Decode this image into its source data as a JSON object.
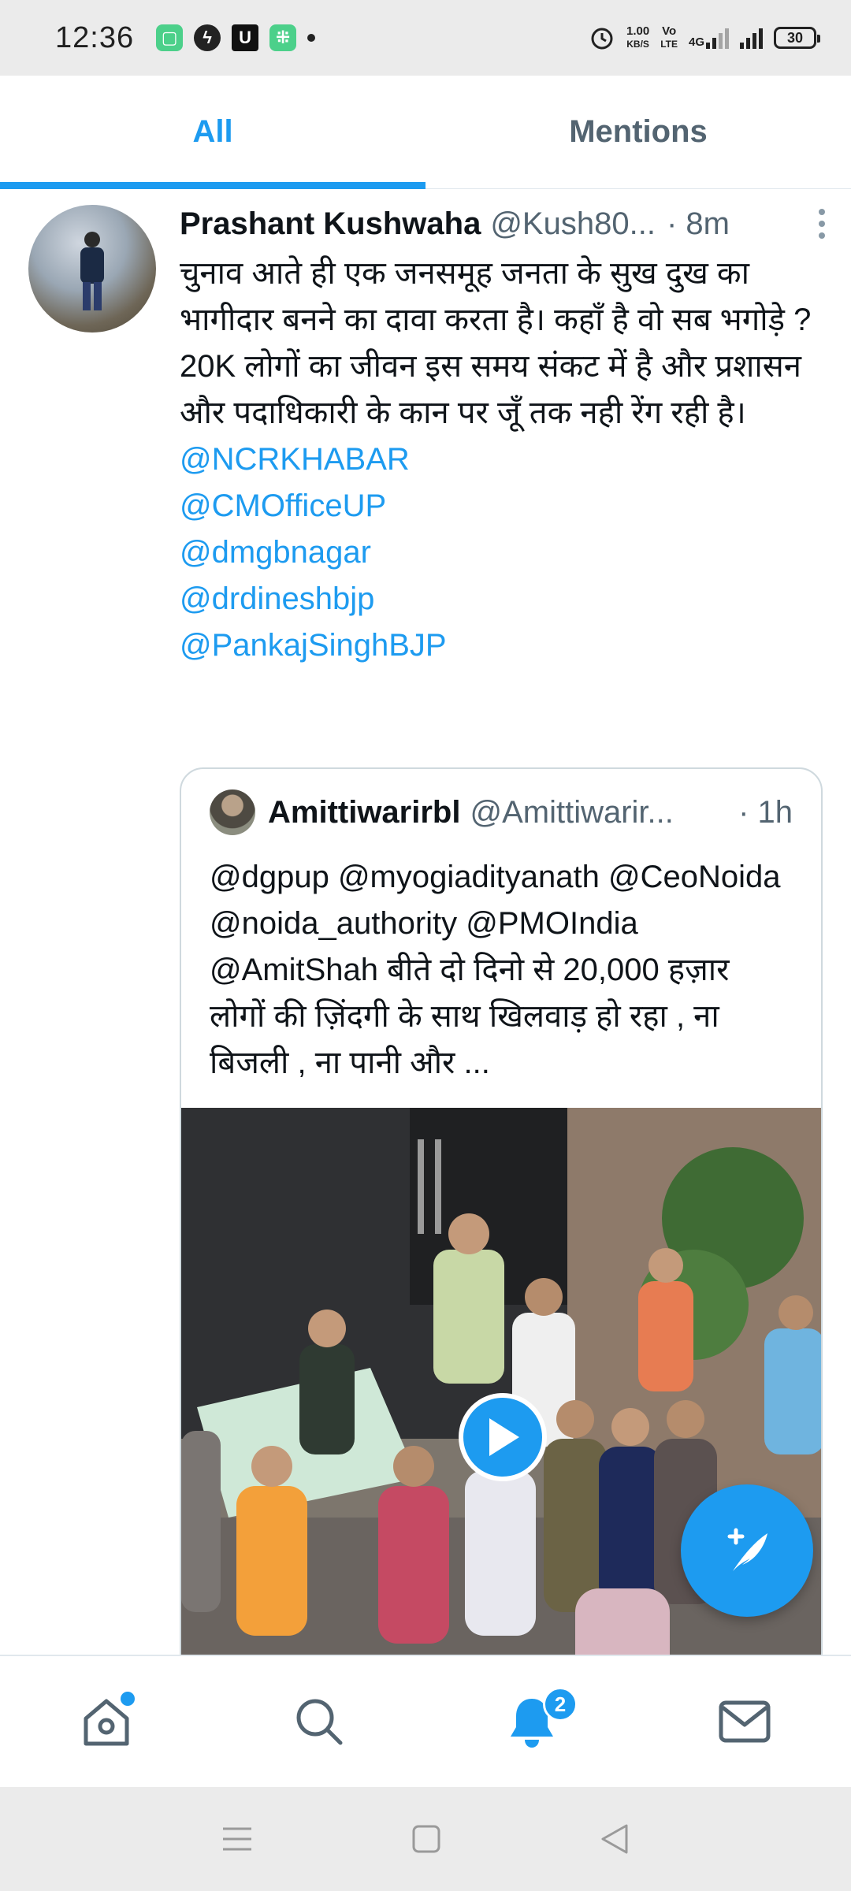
{
  "status_bar": {
    "time": "12:36",
    "net_speed_value": "1.00",
    "net_speed_unit": "KB/S",
    "volte_top": "Vo",
    "volte_bottom": "LTE",
    "network": "4G",
    "battery": "30"
  },
  "tabs": [
    {
      "label": "All",
      "active": true
    },
    {
      "label": "Mentions",
      "active": false
    }
  ],
  "tweet": {
    "name": "Prashant Kushwaha",
    "handle": "@Kush80...",
    "time": "· 8m",
    "text_line1": "चुनाव आते ही एक जनसमूह जनता के सुख दुख का भागीदार बनने का दावा करता है। कहाँ है वो सब भगोड़े ?",
    "text_line2": "20K लोगों का जीवन इस समय संकट में है और प्रशासन और पदाधिकारी के कान पर जूँ तक नही रेंग रही है।",
    "mentions": [
      "@NCRKHABAR",
      "@CMOfficeUP",
      "@dmgbnagar",
      "@drdineshbjp",
      "@PankajSinghBJP"
    ]
  },
  "quote": {
    "name": "Amittiwarirbl",
    "handle": "@Amittiwarir...",
    "time": "· 1h",
    "text": "@dgpup @myogiadityanath @CeoNoida @noida_authority @PMOIndia @AmitShah बीते दो दिनो से 20,000 हज़ार लोगों की ज़िंदगी के साथ खिलवाड़ हो रहा , ना बिजली , ना पानी और ..."
  },
  "bottom_nav": {
    "items": [
      "home-icon",
      "search-icon",
      "notifications-icon",
      "messages-icon"
    ],
    "notification_badge": "2"
  },
  "colors": {
    "accent": "#1d9bf0",
    "text_primary": "#0f1419",
    "text_secondary": "#536471"
  }
}
